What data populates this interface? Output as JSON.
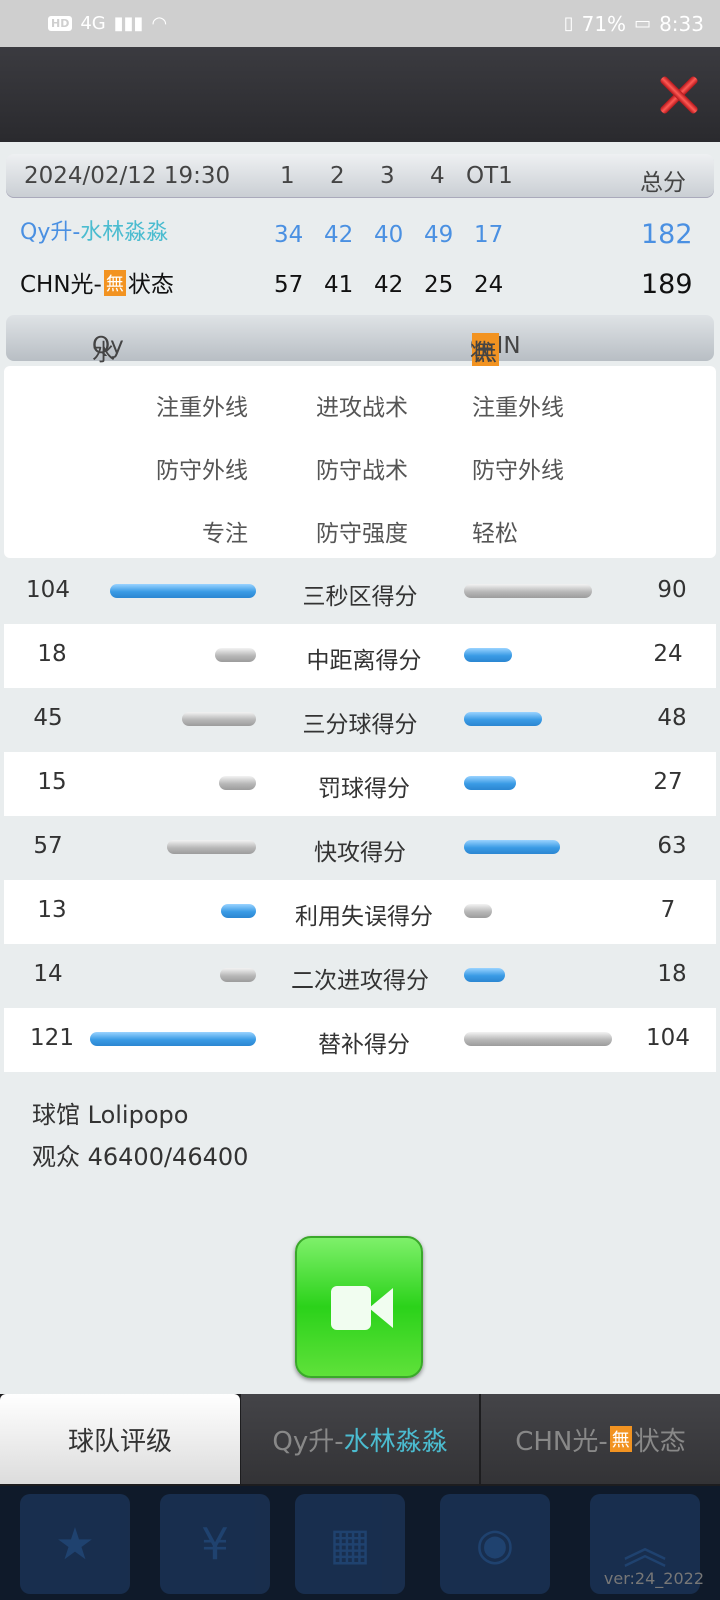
{
  "status_bar": {
    "hd": "HD",
    "network": "4G",
    "battery": "71%",
    "time": "8:33"
  },
  "scoreboard": {
    "datetime": "2024/02/12 19:30",
    "headers": [
      "1",
      "2",
      "3",
      "4",
      "OT1"
    ],
    "total_label": "总分",
    "teams": [
      {
        "name_prefix": "Qy升-",
        "name_suffix": "水林淼淼",
        "scores": [
          "34",
          "42",
          "40",
          "49",
          "17"
        ],
        "total": "182"
      },
      {
        "name_prefix": "CHN光-",
        "name_badge": "無",
        "name_suffix": "状态",
        "scores": [
          "57",
          "41",
          "42",
          "25",
          "24"
        ],
        "total": "189"
      }
    ]
  },
  "compare_header": {
    "left_prefix": "Qy升-",
    "left_suffix": "水林淼淼",
    "right_prefix": "CHN光-",
    "right_badge": "無",
    "right_suffix": "状态"
  },
  "tactics": [
    {
      "left": "注重外线",
      "middle": "进攻战术",
      "right": "注重外线"
    },
    {
      "left": "防守外线",
      "middle": "防守战术",
      "right": "防守外线"
    },
    {
      "left": "专注",
      "middle": "防守强度",
      "right": "轻松"
    }
  ],
  "stats": [
    {
      "label": "三秒区得分",
      "left": "104",
      "right": "90"
    },
    {
      "label": "中距离得分",
      "left": "18",
      "right": "24"
    },
    {
      "label": "三分球得分",
      "left": "45",
      "right": "48"
    },
    {
      "label": "罚球得分",
      "left": "15",
      "right": "27"
    },
    {
      "label": "快攻得分",
      "left": "57",
      "right": "63"
    },
    {
      "label": "利用失误得分",
      "left": "13",
      "right": "7"
    },
    {
      "label": "二次进攻得分",
      "left": "14",
      "right": "18"
    },
    {
      "label": "替补得分",
      "left": "121",
      "right": "104"
    }
  ],
  "venue": {
    "arena": "球馆 Lolipopo",
    "attendance": "观众 46400/46400"
  },
  "tabs": {
    "rating": "球队评级",
    "team1_prefix": "Qy升-",
    "team1_suffix": "水林淼淼",
    "team2_prefix": "CHN光-",
    "team2_badge": "無",
    "team2_suffix": "状态"
  },
  "version": "ver:24_2022",
  "colors": {
    "accent_blue": "#4a90e2",
    "accent_cyan": "#4bbcd0",
    "badge_orange": "#f29321",
    "close_red": "#e0302f",
    "video_green": "#2bd21a"
  }
}
